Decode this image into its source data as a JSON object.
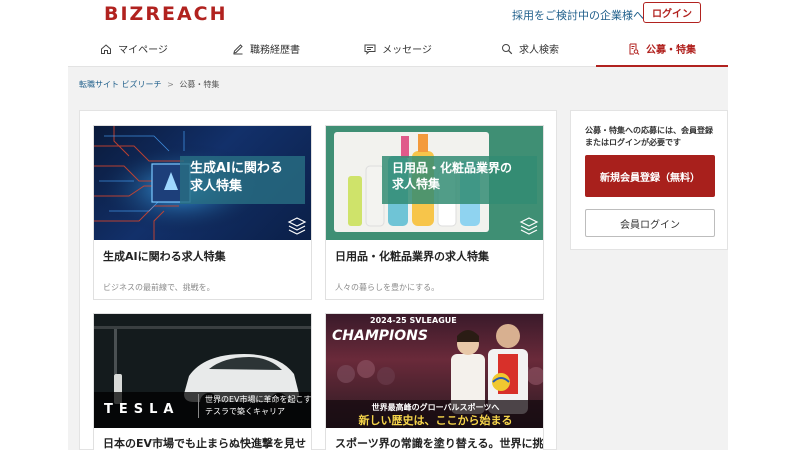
{
  "header": {
    "logo": "BIZREACH",
    "corporate_link": "採用をご検討中の企業様へ",
    "login_label": "ログイン"
  },
  "nav": {
    "items": [
      {
        "label": "マイページ",
        "icon": "home-icon"
      },
      {
        "label": "職務経歴書",
        "icon": "pencil-icon"
      },
      {
        "label": "メッセージ",
        "icon": "message-icon"
      },
      {
        "label": "求人検索",
        "icon": "search-icon"
      },
      {
        "label": "公募・特集",
        "icon": "document-icon"
      }
    ]
  },
  "breadcrumb": {
    "home": "転職サイト ビズリーチ",
    "separator": ">",
    "current": "公募・特集"
  },
  "cards": [
    {
      "image_text_line1": "生成AIに関わる",
      "image_text_line2": "求人特集",
      "title": "生成AIに関わる求人特集",
      "description": "ビジネスの最前線で、挑戦を。"
    },
    {
      "image_text_line1": "日用品・化粧品業界の",
      "image_text_line2": "求人特集",
      "title": "日用品・化粧品業界の求人特集",
      "description": "人々の暮らしを豊かにする。"
    },
    {
      "image_brand": "TESLA",
      "image_text_line1": "世界のEV市場に革命を起こす",
      "image_text_line2": "テスラで築くキャリア",
      "title": "日本のEV市場でも止まらぬ快進撃を見せ"
    },
    {
      "image_text_top": "2024-25 SVLEAGUE",
      "image_text_champions": "CHAMPIONS",
      "image_text_line1": "世界最高峰のグローバルスポーツへ",
      "image_text_line2": "新しい歴史は、ここから始まる",
      "title": "スポーツ界の常識を塗り替える。世界に挑"
    }
  ],
  "sidebar": {
    "note": "公募・特集への応募には、会員登録またはログインが必要です",
    "register_label": "新規会員登録（無料）",
    "login_label": "会員ログイン"
  },
  "colors": {
    "brand": "#b1221f",
    "link": "#1f5f8b",
    "overlay": "#286e78"
  }
}
